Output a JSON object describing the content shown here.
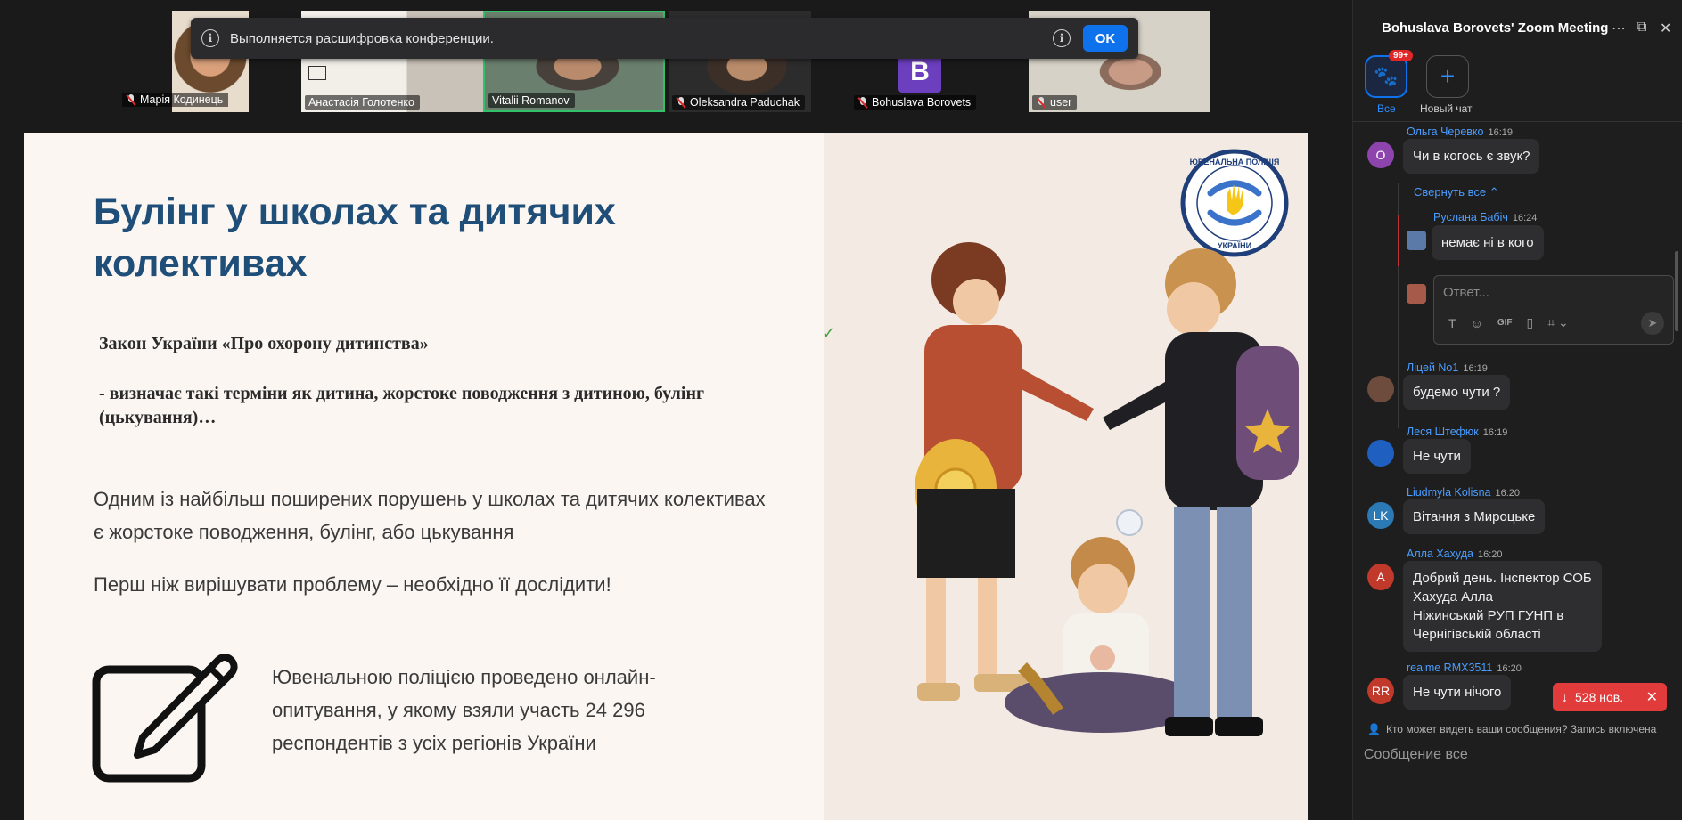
{
  "participants": [
    {
      "name": "Марія Кодинець",
      "muted": true
    },
    {
      "name": "Анастасія Голотенко",
      "muted": false
    },
    {
      "name": "Vitalii Romanov",
      "muted": false
    },
    {
      "name": "Oleksandra Paduchak",
      "muted": true
    },
    {
      "name": "Bohuslava Borovets",
      "muted": true,
      "initial": "B"
    },
    {
      "name": "user",
      "muted": true
    }
  ],
  "banner": {
    "text": "Выполняется расшифровка конференции.",
    "ok_label": "OK"
  },
  "slide": {
    "title": "Булінг у школах та дитячих колективах",
    "law_title": "Закон України «Про охорону дитинства»",
    "law_desc": "- визначає такі терміни як дитина, жорстоке поводження з дитиною, булінг (цькування)…",
    "para1": "Одним із найбільш поширених порушень у школах та дитячих колективах є жорстоке поводження, булінг, або цькування",
    "para2": "Перш ніж вирішувати проблему – необхідно її дослідити!",
    "survey": "Ювенальною поліцією проведено онлайн-опитування, у якому взяли участь 24 296 респондентів з усіх регіонів України",
    "logo_text": "ЮВЕНАЛЬНА ПОЛІЦІЯ УКРАЇНИ"
  },
  "chat": {
    "title": "Bohuslava Borovets' Zoom Meeting",
    "tab_all_label": "Все",
    "tab_new_label": "Новый чат",
    "badge": "99+",
    "collapse_label": "Свернуть все ⌃",
    "reply_placeholder": "Ответ...",
    "new_messages": "528 нов.",
    "visibility_note": "Кто может видеть ваши сообщения? Запись включена",
    "input_placeholder": "Сообщение все",
    "accent": "#0e72ed",
    "messages": [
      {
        "sender": "Ольга Черевко",
        "time": "16:19",
        "text": "Чи в когось є звук?",
        "initial": "О",
        "color": "#8e44ad"
      },
      {
        "sender": "Руслана Бабіч",
        "time": "16:24",
        "text": "немає ні в кого",
        "initial": "",
        "color": "#5b7aa8"
      },
      {
        "sender": "Ліцей No1",
        "time": "16:19",
        "text": "будемо чути ?",
        "initial": "",
        "color": "#6d4c3d"
      },
      {
        "sender": "Леся Штефюк",
        "time": "16:19",
        "text": "Не чути",
        "initial": "",
        "color": "#1f5fbf"
      },
      {
        "sender": "Liudmyla Kolisna",
        "time": "16:20",
        "text": "Вітання  з Мироцьке",
        "initial": "LK",
        "color": "#2b79b5"
      },
      {
        "sender": "Алла Хахуда",
        "time": "16:20",
        "lines": [
          "Добрий день. Інспектор СОБ",
          "Хахуда Алла",
          "Ніжинський РУП ГУНП в",
          "Чернігівській області"
        ],
        "initial": "А",
        "color": "#c0392b"
      },
      {
        "sender": "realme RMX3511",
        "time": "16:20",
        "text": "Не чути нічого",
        "initial": "RR",
        "color": "#c0392b"
      }
    ]
  }
}
